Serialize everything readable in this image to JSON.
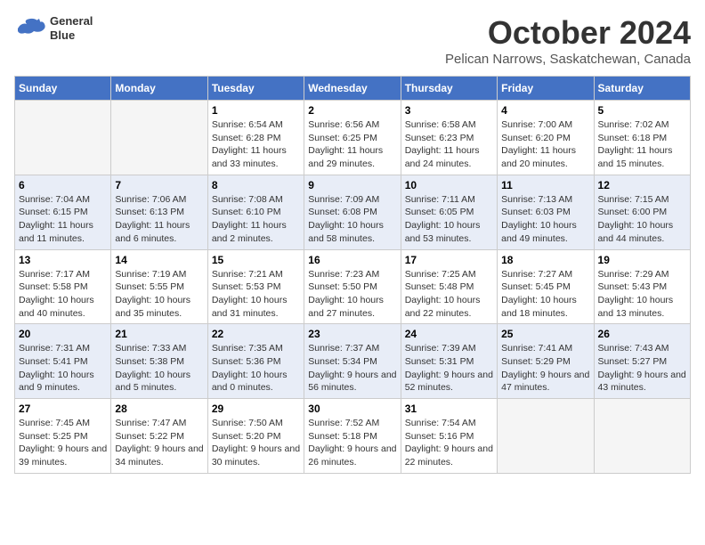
{
  "header": {
    "logo_line1": "General",
    "logo_line2": "Blue",
    "month": "October 2024",
    "location": "Pelican Narrows, Saskatchewan, Canada"
  },
  "days_of_week": [
    "Sunday",
    "Monday",
    "Tuesday",
    "Wednesday",
    "Thursday",
    "Friday",
    "Saturday"
  ],
  "weeks": [
    [
      {
        "day": "",
        "sunrise": "",
        "sunset": "",
        "daylight": ""
      },
      {
        "day": "",
        "sunrise": "",
        "sunset": "",
        "daylight": ""
      },
      {
        "day": "1",
        "sunrise": "Sunrise: 6:54 AM",
        "sunset": "Sunset: 6:28 PM",
        "daylight": "Daylight: 11 hours and 33 minutes."
      },
      {
        "day": "2",
        "sunrise": "Sunrise: 6:56 AM",
        "sunset": "Sunset: 6:25 PM",
        "daylight": "Daylight: 11 hours and 29 minutes."
      },
      {
        "day": "3",
        "sunrise": "Sunrise: 6:58 AM",
        "sunset": "Sunset: 6:23 PM",
        "daylight": "Daylight: 11 hours and 24 minutes."
      },
      {
        "day": "4",
        "sunrise": "Sunrise: 7:00 AM",
        "sunset": "Sunset: 6:20 PM",
        "daylight": "Daylight: 11 hours and 20 minutes."
      },
      {
        "day": "5",
        "sunrise": "Sunrise: 7:02 AM",
        "sunset": "Sunset: 6:18 PM",
        "daylight": "Daylight: 11 hours and 15 minutes."
      }
    ],
    [
      {
        "day": "6",
        "sunrise": "Sunrise: 7:04 AM",
        "sunset": "Sunset: 6:15 PM",
        "daylight": "Daylight: 11 hours and 11 minutes."
      },
      {
        "day": "7",
        "sunrise": "Sunrise: 7:06 AM",
        "sunset": "Sunset: 6:13 PM",
        "daylight": "Daylight: 11 hours and 6 minutes."
      },
      {
        "day": "8",
        "sunrise": "Sunrise: 7:08 AM",
        "sunset": "Sunset: 6:10 PM",
        "daylight": "Daylight: 11 hours and 2 minutes."
      },
      {
        "day": "9",
        "sunrise": "Sunrise: 7:09 AM",
        "sunset": "Sunset: 6:08 PM",
        "daylight": "Daylight: 10 hours and 58 minutes."
      },
      {
        "day": "10",
        "sunrise": "Sunrise: 7:11 AM",
        "sunset": "Sunset: 6:05 PM",
        "daylight": "Daylight: 10 hours and 53 minutes."
      },
      {
        "day": "11",
        "sunrise": "Sunrise: 7:13 AM",
        "sunset": "Sunset: 6:03 PM",
        "daylight": "Daylight: 10 hours and 49 minutes."
      },
      {
        "day": "12",
        "sunrise": "Sunrise: 7:15 AM",
        "sunset": "Sunset: 6:00 PM",
        "daylight": "Daylight: 10 hours and 44 minutes."
      }
    ],
    [
      {
        "day": "13",
        "sunrise": "Sunrise: 7:17 AM",
        "sunset": "Sunset: 5:58 PM",
        "daylight": "Daylight: 10 hours and 40 minutes."
      },
      {
        "day": "14",
        "sunrise": "Sunrise: 7:19 AM",
        "sunset": "Sunset: 5:55 PM",
        "daylight": "Daylight: 10 hours and 35 minutes."
      },
      {
        "day": "15",
        "sunrise": "Sunrise: 7:21 AM",
        "sunset": "Sunset: 5:53 PM",
        "daylight": "Daylight: 10 hours and 31 minutes."
      },
      {
        "day": "16",
        "sunrise": "Sunrise: 7:23 AM",
        "sunset": "Sunset: 5:50 PM",
        "daylight": "Daylight: 10 hours and 27 minutes."
      },
      {
        "day": "17",
        "sunrise": "Sunrise: 7:25 AM",
        "sunset": "Sunset: 5:48 PM",
        "daylight": "Daylight: 10 hours and 22 minutes."
      },
      {
        "day": "18",
        "sunrise": "Sunrise: 7:27 AM",
        "sunset": "Sunset: 5:45 PM",
        "daylight": "Daylight: 10 hours and 18 minutes."
      },
      {
        "day": "19",
        "sunrise": "Sunrise: 7:29 AM",
        "sunset": "Sunset: 5:43 PM",
        "daylight": "Daylight: 10 hours and 13 minutes."
      }
    ],
    [
      {
        "day": "20",
        "sunrise": "Sunrise: 7:31 AM",
        "sunset": "Sunset: 5:41 PM",
        "daylight": "Daylight: 10 hours and 9 minutes."
      },
      {
        "day": "21",
        "sunrise": "Sunrise: 7:33 AM",
        "sunset": "Sunset: 5:38 PM",
        "daylight": "Daylight: 10 hours and 5 minutes."
      },
      {
        "day": "22",
        "sunrise": "Sunrise: 7:35 AM",
        "sunset": "Sunset: 5:36 PM",
        "daylight": "Daylight: 10 hours and 0 minutes."
      },
      {
        "day": "23",
        "sunrise": "Sunrise: 7:37 AM",
        "sunset": "Sunset: 5:34 PM",
        "daylight": "Daylight: 9 hours and 56 minutes."
      },
      {
        "day": "24",
        "sunrise": "Sunrise: 7:39 AM",
        "sunset": "Sunset: 5:31 PM",
        "daylight": "Daylight: 9 hours and 52 minutes."
      },
      {
        "day": "25",
        "sunrise": "Sunrise: 7:41 AM",
        "sunset": "Sunset: 5:29 PM",
        "daylight": "Daylight: 9 hours and 47 minutes."
      },
      {
        "day": "26",
        "sunrise": "Sunrise: 7:43 AM",
        "sunset": "Sunset: 5:27 PM",
        "daylight": "Daylight: 9 hours and 43 minutes."
      }
    ],
    [
      {
        "day": "27",
        "sunrise": "Sunrise: 7:45 AM",
        "sunset": "Sunset: 5:25 PM",
        "daylight": "Daylight: 9 hours and 39 minutes."
      },
      {
        "day": "28",
        "sunrise": "Sunrise: 7:47 AM",
        "sunset": "Sunset: 5:22 PM",
        "daylight": "Daylight: 9 hours and 34 minutes."
      },
      {
        "day": "29",
        "sunrise": "Sunrise: 7:50 AM",
        "sunset": "Sunset: 5:20 PM",
        "daylight": "Daylight: 9 hours and 30 minutes."
      },
      {
        "day": "30",
        "sunrise": "Sunrise: 7:52 AM",
        "sunset": "Sunset: 5:18 PM",
        "daylight": "Daylight: 9 hours and 26 minutes."
      },
      {
        "day": "31",
        "sunrise": "Sunrise: 7:54 AM",
        "sunset": "Sunset: 5:16 PM",
        "daylight": "Daylight: 9 hours and 22 minutes."
      },
      {
        "day": "",
        "sunrise": "",
        "sunset": "",
        "daylight": ""
      },
      {
        "day": "",
        "sunrise": "",
        "sunset": "",
        "daylight": ""
      }
    ]
  ]
}
